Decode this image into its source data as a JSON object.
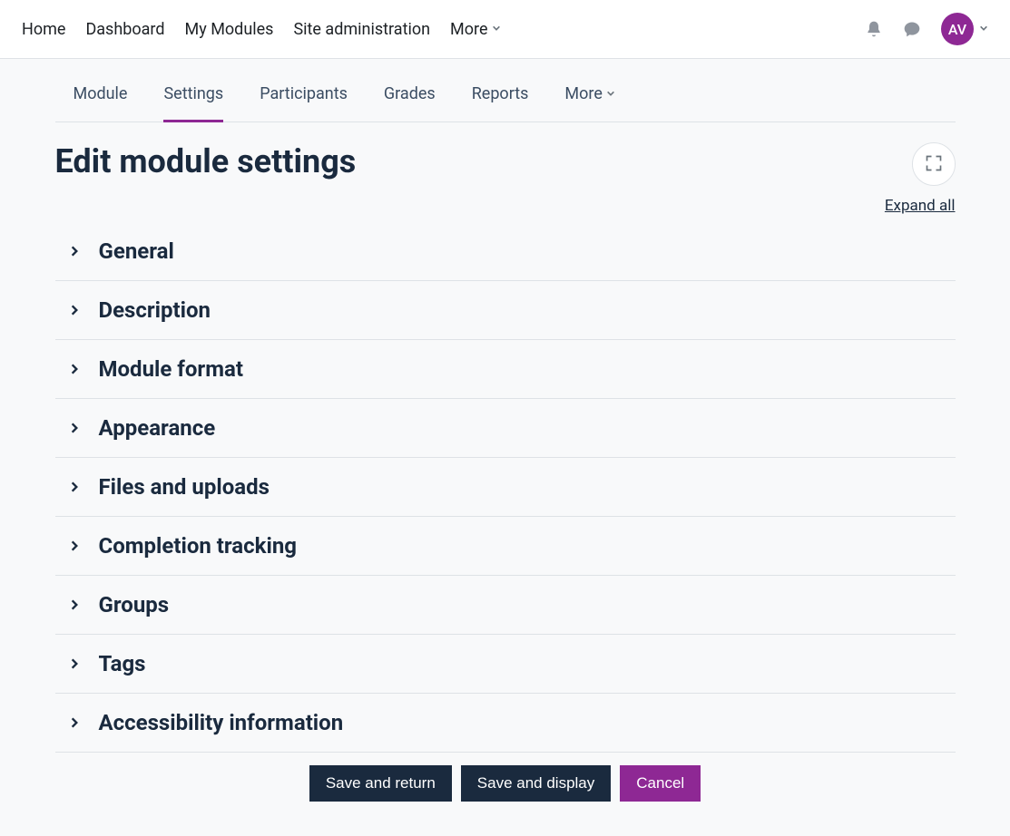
{
  "global_nav": {
    "items": [
      {
        "label": "Home"
      },
      {
        "label": "Dashboard"
      },
      {
        "label": "My Modules"
      },
      {
        "label": "Site administration"
      },
      {
        "label": "More",
        "dropdown": true
      }
    ]
  },
  "topbar": {
    "avatar_initials": "AV"
  },
  "secondary_nav": {
    "items": [
      {
        "label": "Module"
      },
      {
        "label": "Settings",
        "active": true
      },
      {
        "label": "Participants"
      },
      {
        "label": "Grades"
      },
      {
        "label": "Reports"
      },
      {
        "label": "More",
        "dropdown": true
      }
    ]
  },
  "page": {
    "title": "Edit module settings",
    "expand_all": "Expand all"
  },
  "sections": [
    {
      "title": "General"
    },
    {
      "title": "Description"
    },
    {
      "title": "Module format"
    },
    {
      "title": "Appearance"
    },
    {
      "title": "Files and uploads"
    },
    {
      "title": "Completion tracking"
    },
    {
      "title": "Groups"
    },
    {
      "title": "Tags"
    },
    {
      "title": "Accessibility information"
    }
  ],
  "actions": {
    "save_return": "Save and return",
    "save_display": "Save and display",
    "cancel": "Cancel"
  }
}
